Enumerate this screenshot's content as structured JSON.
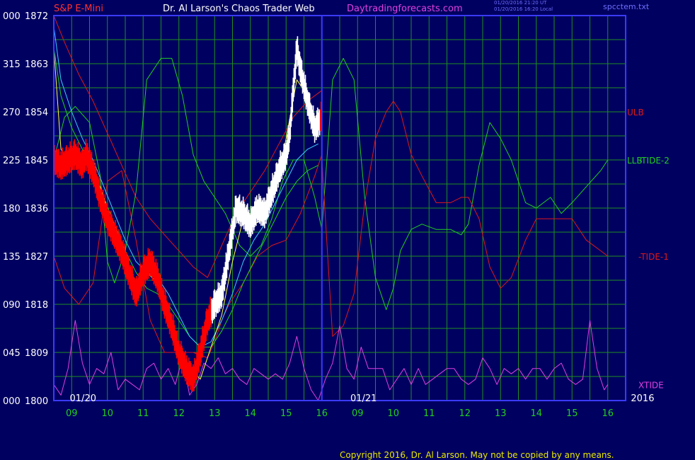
{
  "header": {
    "instrument": "S&P E-Mini",
    "site_title": "Dr. Al Larson's Chaos Trader Web",
    "site_url": "Daytradingforecasts.com",
    "timestamp_ut": "01/20/2016 21:20 UT",
    "timestamp_local": "01/20/2016 16:20 Local",
    "file_name": "spcctem.txt"
  },
  "footer": {
    "copyright": "Copyright 2016, Dr. Al Larson. May not be copied by any means."
  },
  "colors": {
    "background": "#000060",
    "frame": "#3a3aff",
    "grid": "#1f8f1f",
    "price": "#ff0000",
    "price_up": "#ffffff",
    "ma_yellow": "#ffff40",
    "ma_cyan": "#3ccfff",
    "ma_green": "#20d020",
    "band": "#e01818",
    "tide": "#20d020",
    "xtide": "#e040e0",
    "axis_text": "#ffffff",
    "date_text": "#20d020"
  },
  "chart_data": {
    "type": "line",
    "ylim": [
      1800,
      1872
    ],
    "y_ticks": [
      {
        "left": "000",
        "price": "1872",
        "value": 1872
      },
      {
        "left": "315",
        "price": "1863",
        "value": 1863
      },
      {
        "left": "270",
        "price": "1854",
        "value": 1854
      },
      {
        "left": "225",
        "price": "1845",
        "value": 1845
      },
      {
        "left": "180",
        "price": "1836",
        "value": 1836
      },
      {
        "left": "135",
        "price": "1827",
        "value": 1827
      },
      {
        "left": "090",
        "price": "1818",
        "value": 1818
      },
      {
        "left": "045",
        "price": "1809",
        "value": 1809
      },
      {
        "left": "000",
        "price": "1800",
        "value": 1800
      }
    ],
    "x_range": [
      8.5,
      24.5
    ],
    "x_ticks": [
      {
        "label": "09",
        "x": 9
      },
      {
        "label": "10",
        "x": 10
      },
      {
        "label": "11",
        "x": 11
      },
      {
        "label": "12",
        "x": 12
      },
      {
        "label": "13",
        "x": 13
      },
      {
        "label": "14",
        "x": 14
      },
      {
        "label": "15",
        "x": 15
      },
      {
        "label": "16",
        "x": 16
      },
      {
        "label": "09",
        "x": 17
      },
      {
        "label": "10",
        "x": 18
      },
      {
        "label": "11",
        "x": 19
      },
      {
        "label": "12",
        "x": 20
      },
      {
        "label": "13",
        "x": 21
      },
      {
        "label": "14",
        "x": 22
      },
      {
        "label": "15",
        "x": 23
      },
      {
        "label": "16",
        "x": 24
      }
    ],
    "date_markers": [
      {
        "label": "01/20",
        "x": 8.55
      },
      {
        "label": "01/21",
        "x": 16.4
      },
      {
        "label": "2016",
        "x": 24.25
      }
    ],
    "day_separator_x": 16,
    "right_labels": [
      {
        "text": "ULB",
        "value": 1854,
        "color": "#e01818"
      },
      {
        "text": "LLB",
        "value": 1845,
        "color": "#20d020"
      },
      {
        "text": "-TIDE-2",
        "value": 1845,
        "color": "#20d020"
      },
      {
        "text": "-TIDE-1",
        "value": 1827,
        "color": "#e01818"
      },
      {
        "text": "XTIDE",
        "value": 1803,
        "color": "#e040e0"
      }
    ],
    "price": {
      "name": "S&P E-Mini",
      "x": [
        8.5,
        8.7,
        8.9,
        9.1,
        9.3,
        9.4,
        9.6,
        9.8,
        10.0,
        10.2,
        10.4,
        10.6,
        10.8,
        11.0,
        11.2,
        11.4,
        11.6,
        11.8,
        12.0,
        12.2,
        12.4,
        12.6,
        12.8,
        13.0,
        13.2,
        13.4,
        13.6,
        13.8,
        14.0,
        14.2,
        14.4,
        14.6,
        14.8,
        15.0,
        15.1,
        15.2,
        15.3,
        15.4,
        15.6,
        15.8,
        16.0
      ],
      "y": [
        1845,
        1844,
        1845,
        1846,
        1844,
        1846,
        1843,
        1838,
        1834,
        1831,
        1828,
        1824,
        1820,
        1824,
        1826,
        1823,
        1818,
        1814,
        1809,
        1806,
        1804,
        1809,
        1815,
        1818,
        1820,
        1828,
        1836,
        1835,
        1833,
        1836,
        1835,
        1839,
        1843,
        1846,
        1850,
        1858,
        1866,
        1862,
        1856,
        1851,
        1853
      ]
    },
    "ma_yellow": {
      "x": [
        8.5,
        8.7,
        9.0,
        9.3,
        9.6,
        9.9,
        10.2,
        10.5,
        10.8,
        11.1,
        11.4,
        11.7,
        12.0,
        12.3,
        12.6,
        12.9,
        13.2,
        13.5,
        13.8,
        14.1,
        14.4,
        14.7,
        15.0,
        15.3,
        15.6,
        15.9
      ],
      "y": [
        1866,
        1847,
        1844,
        1845,
        1844,
        1838,
        1831,
        1826,
        1821,
        1824,
        1822,
        1816,
        1810,
        1806,
        1804,
        1810,
        1816,
        1826,
        1834,
        1833,
        1834,
        1840,
        1849,
        1860,
        1857,
        1851
      ]
    },
    "ma_cyan": {
      "x": [
        8.5,
        8.7,
        9.0,
        9.3,
        9.6,
        9.9,
        10.2,
        10.5,
        10.8,
        11.1,
        11.4,
        11.7,
        12.0,
        12.3,
        12.6,
        12.9,
        13.2,
        13.5,
        13.8,
        14.1,
        14.4,
        14.7,
        15.0,
        15.3,
        15.6,
        15.9
      ],
      "y": [
        1870,
        1860,
        1854,
        1849,
        1845,
        1840,
        1835,
        1830,
        1826,
        1824,
        1823,
        1820,
        1816,
        1812,
        1810,
        1811,
        1815,
        1820,
        1826,
        1830,
        1833,
        1837,
        1841,
        1845,
        1847,
        1848
      ]
    },
    "ma_green": {
      "x": [
        8.5,
        8.7,
        9.0,
        9.3,
        9.6,
        9.9,
        10.2,
        10.5,
        10.8,
        11.1,
        11.4,
        11.7,
        12.0,
        12.3,
        12.6,
        12.9,
        13.2,
        13.5,
        13.8,
        14.1,
        14.4,
        14.7,
        15.0,
        15.3,
        15.6,
        15.9
      ],
      "y": [
        1866,
        1857,
        1851,
        1847,
        1843,
        1838,
        1833,
        1828,
        1824,
        1821,
        1820,
        1818,
        1815,
        1812,
        1810,
        1810,
        1813,
        1817,
        1822,
        1826,
        1830,
        1834,
        1838,
        1841,
        1843,
        1844
      ]
    },
    "upper_band": {
      "x": [
        8.5,
        8.8,
        9.2,
        9.6,
        10.0,
        10.4,
        10.8,
        11.2,
        11.6,
        12.0,
        12.4,
        12.8,
        13.0,
        13.2,
        13.6,
        14.0,
        14.4,
        14.8,
        15.2,
        15.6,
        16.0
      ],
      "y": [
        1872,
        1867,
        1861,
        1856,
        1850,
        1844,
        1838,
        1834,
        1831,
        1828,
        1825,
        1823,
        1826,
        1829,
        1835,
        1839,
        1843,
        1848,
        1853,
        1856,
        1858
      ]
    },
    "lower_band": {
      "x": [
        8.5,
        8.8,
        9.2,
        9.6,
        10.0,
        10.4,
        10.8,
        11.2,
        11.6,
        12.0,
        12.4,
        12.8,
        13.0,
        13.2,
        13.4,
        13.8,
        14.2,
        14.6,
        15.0,
        15.4,
        15.8,
        16.0
      ],
      "y": [
        1827,
        1821,
        1818,
        1822,
        1841,
        1843,
        1830,
        1815,
        1809,
        1809,
        1809,
        1808,
        1811,
        1815,
        1818,
        1822,
        1827,
        1829,
        1830,
        1835,
        1842,
        1846
      ]
    },
    "tide_2": {
      "name": "-TIDE-2",
      "x": [
        8.5,
        8.8,
        9.1,
        9.5,
        9.8,
        10.0,
        10.2,
        10.5,
        10.8,
        11.1,
        11.5,
        11.8,
        12.1,
        12.4,
        12.7,
        13.0,
        13.3,
        13.7,
        14.0,
        14.3,
        14.6,
        14.9,
        15.2,
        15.5,
        15.8,
        16.0,
        16.3,
        16.6,
        16.9,
        17.2,
        17.5,
        17.8,
        18.0,
        18.2,
        18.5,
        18.8,
        19.2,
        19.6,
        19.9,
        20.1,
        20.4,
        20.7,
        21.0,
        21.3,
        21.7,
        22.0,
        22.4,
        22.7,
        23.0,
        23.4,
        23.8,
        24.0
      ],
      "y": [
        1845,
        1853,
        1855,
        1852,
        1842,
        1826,
        1822,
        1828,
        1839,
        1860,
        1864,
        1864,
        1857,
        1846,
        1841,
        1838,
        1835,
        1829,
        1827,
        1829,
        1834,
        1841,
        1845,
        1845,
        1838,
        1832,
        1860,
        1864,
        1860,
        1838,
        1823,
        1817,
        1821,
        1828,
        1832,
        1833,
        1832,
        1832,
        1831,
        1833,
        1844,
        1852,
        1849,
        1845,
        1837,
        1836,
        1838,
        1835,
        1837,
        1840,
        1843,
        1845
      ]
    },
    "tide_1": {
      "name": "-TIDE-1",
      "x": [
        16.0,
        16.3,
        16.6,
        16.9,
        17.2,
        17.5,
        17.8,
        18.0,
        18.2,
        18.5,
        18.8,
        19.2,
        19.6,
        19.9,
        20.1,
        20.4,
        20.7,
        21.0,
        21.3,
        21.7,
        22.0,
        22.4,
        22.7,
        23.0,
        23.4,
        23.8,
        24.0
      ],
      "y": [
        1845,
        1812,
        1814,
        1820,
        1837,
        1849,
        1854,
        1856,
        1854,
        1846,
        1842,
        1837,
        1837,
        1838,
        1838,
        1834,
        1825,
        1821,
        1823,
        1830,
        1834,
        1834,
        1834,
        1834,
        1830,
        1828,
        1827
      ]
    },
    "xtide": {
      "name": "XTIDE",
      "x": [
        8.5,
        8.7,
        8.9,
        9.1,
        9.3,
        9.5,
        9.7,
        9.9,
        10.1,
        10.3,
        10.5,
        10.7,
        10.9,
        11.1,
        11.3,
        11.5,
        11.7,
        11.9,
        12.1,
        12.3,
        12.5,
        12.7,
        12.9,
        13.1,
        13.3,
        13.5,
        13.7,
        13.9,
        14.1,
        14.3,
        14.5,
        14.7,
        14.9,
        15.1,
        15.3,
        15.5,
        15.7,
        15.9,
        16.1,
        16.3,
        16.5,
        16.7,
        16.9,
        17.1,
        17.3,
        17.5,
        17.7,
        17.9,
        18.1,
        18.3,
        18.5,
        18.7,
        18.9,
        19.1,
        19.3,
        19.5,
        19.7,
        19.9,
        20.1,
        20.3,
        20.5,
        20.7,
        20.9,
        21.1,
        21.3,
        21.5,
        21.7,
        21.9,
        22.1,
        22.3,
        22.5,
        22.7,
        22.9,
        23.1,
        23.3,
        23.5,
        23.7,
        23.9,
        24.0
      ],
      "y": [
        1803,
        1801,
        1806,
        1815,
        1807,
        1803,
        1806,
        1805,
        1809,
        1802,
        1804,
        1803,
        1802,
        1806,
        1807,
        1804,
        1806,
        1803,
        1808,
        1801,
        1803,
        1807,
        1806,
        1808,
        1805,
        1806,
        1804,
        1803,
        1806,
        1805,
        1804,
        1805,
        1804,
        1807,
        1812,
        1806,
        1802,
        1800,
        1804,
        1807,
        1814,
        1806,
        1804,
        1810,
        1806,
        1806,
        1806,
        1802,
        1804,
        1806,
        1803,
        1806,
        1803,
        1804,
        1805,
        1806,
        1806,
        1804,
        1803,
        1804,
        1808,
        1806,
        1803,
        1806,
        1805,
        1806,
        1804,
        1806,
        1806,
        1804,
        1806,
        1807,
        1804,
        1803,
        1804,
        1815,
        1806,
        1802,
        1803
      ]
    }
  }
}
